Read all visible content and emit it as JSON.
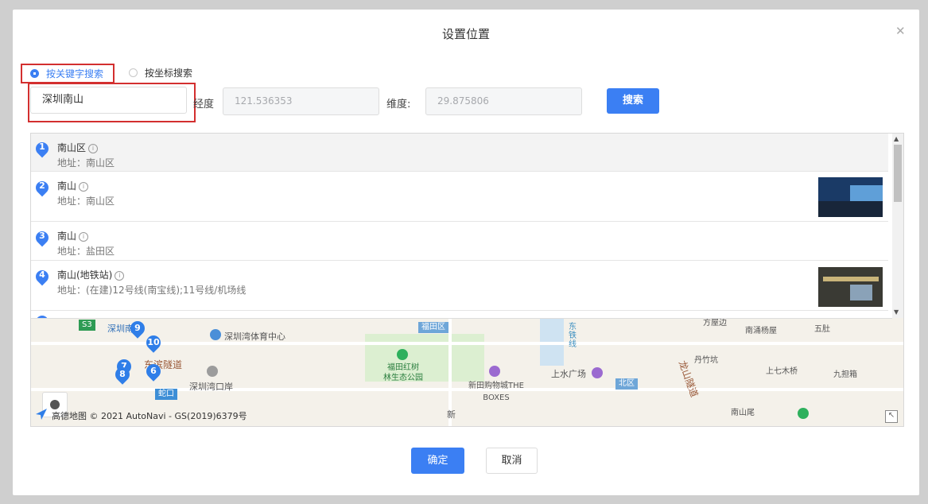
{
  "dialog": {
    "title": "设置位置",
    "close_icon": "close-icon"
  },
  "search_mode": {
    "options": [
      {
        "label": "按关键字搜索",
        "selected": true
      },
      {
        "label": "按坐标搜索",
        "selected": false
      }
    ]
  },
  "form": {
    "keyword_value": "深圳南山",
    "longitude_label": "经度",
    "longitude_value": "121.536353",
    "latitude_label": "维度:",
    "latitude_value": "29.875806",
    "search_label": "搜索"
  },
  "results": [
    {
      "index": "1",
      "name": "南山区",
      "address": "地址：南山区",
      "has_photo": false
    },
    {
      "index": "2",
      "name": "南山",
      "address": "地址：南山区",
      "has_photo": true
    },
    {
      "index": "3",
      "name": "南山",
      "address": "地址：盐田区",
      "has_photo": false
    },
    {
      "index": "4",
      "name": "南山(地铁站)",
      "address": "地址：(在建)12号线(南宝线);11号线/机场线",
      "has_photo": true
    }
  ],
  "map": {
    "labels": {
      "futian": "福田区",
      "shenzhen_bay_sports": "深圳湾体育中心",
      "donghai_tunnel": "东滨隧道",
      "shenzhen_bay_port": "深圳湾口岸",
      "shekou": "蛇口",
      "futian_mangrove": "福田红树\n林生态公园",
      "xintian_mall": "新田购物城THE\nBOXES",
      "shangshui_plaza": "上水广场",
      "beiqu": "北区",
      "longshan_tunnel": "龙山隧道",
      "fangwubian": "方屋边",
      "nanyongyangwu": "南涌杨屋",
      "wushi": "五肚",
      "danzhukeng": "丹竹坑",
      "shangqimuqiao": "上七木桥",
      "jiubahan": "九担箱",
      "nanshanwei": "南山尾",
      "shenzhen_nan": "深圳南",
      "rail_line": "东\n铁\n线",
      "xin": "新",
      "s3": "S3",
      "pin_9": "9",
      "pin_10": "10",
      "pin_7": "7",
      "pin_8": "8",
      "pin_6": "6"
    },
    "copyright": "高德地图 © 2021 AutoNavi - GS(2019)6379号"
  },
  "footer": {
    "confirm_label": "确定",
    "cancel_label": "取消"
  },
  "colors": {
    "primary": "#3b7ff3",
    "highlight_border": "#d32f2f"
  }
}
